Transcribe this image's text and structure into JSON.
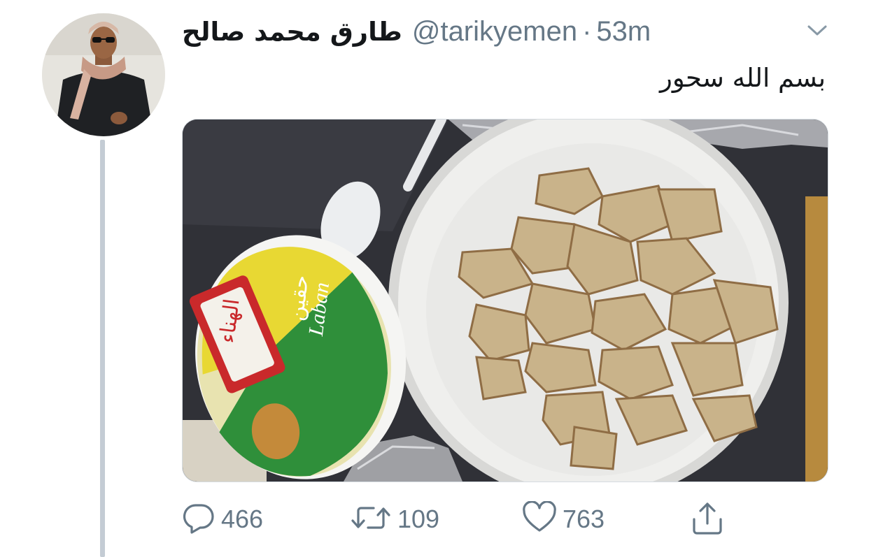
{
  "tweet": {
    "display_name": "طارق محمد صالح",
    "handle": "@tarikyemen",
    "separator": "·",
    "time": "53m",
    "text": "بسم الله سحور",
    "photo": {
      "cup_brand": "الهناء",
      "cup_product_ar": "حقين",
      "cup_product_en": "Laban"
    }
  },
  "actions": {
    "reply_count": "466",
    "retweet_count": "109",
    "like_count": "763"
  },
  "colors": {
    "text": "#14171a",
    "secondary": "#657786",
    "thread_line": "#c4ccd4"
  },
  "icons": [
    "chevron-down-icon",
    "reply-icon",
    "retweet-icon",
    "like-icon",
    "share-icon"
  ]
}
